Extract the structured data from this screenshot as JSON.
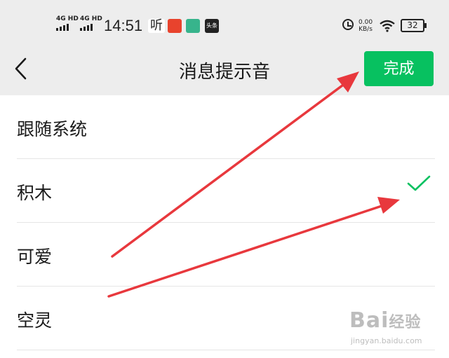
{
  "status_bar": {
    "signal1": "4G HD",
    "signal2": "4G HD",
    "time": "14:51",
    "app_listen": "听",
    "app_toutiao": "头条",
    "net_speed_value": "0.00",
    "net_speed_unit": "KB/s",
    "battery": "32"
  },
  "header": {
    "title": "消息提示音",
    "back_icon": "chevron-left-icon",
    "done_label": "完成",
    "done_color": "#07c160"
  },
  "sound_options": [
    {
      "label": "跟随系统",
      "selected": false
    },
    {
      "label": "积木",
      "selected": true
    },
    {
      "label": "可爱",
      "selected": false
    },
    {
      "label": "空灵",
      "selected": false
    }
  ],
  "check_icon": "checkmark-icon",
  "check_color": "#07c160",
  "annotation_color": "#e8383d",
  "watermark": {
    "brand": "Bai",
    "brand2": "经验",
    "url": "jingyan.baidu.com"
  }
}
